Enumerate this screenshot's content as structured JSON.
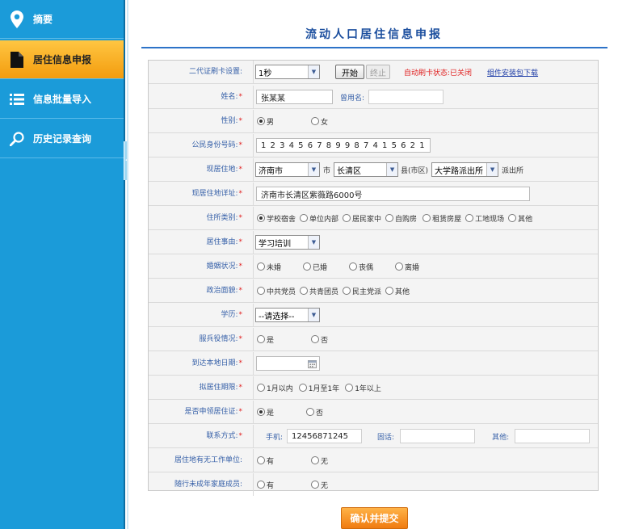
{
  "sidebar": {
    "items": [
      {
        "label": "摘要",
        "icon": "map-pin-icon"
      },
      {
        "label": "居住信息申报",
        "icon": "document-icon"
      },
      {
        "label": "信息批量导入",
        "icon": "list-icon"
      },
      {
        "label": "历史记录查询",
        "icon": "search-icon"
      }
    ]
  },
  "page": {
    "title": "流动人口居住信息申报"
  },
  "form": {
    "card_reader": {
      "label": "二代证刷卡设置:",
      "interval": "1秒",
      "start": "开始",
      "stop": "终止",
      "status": "自动刷卡状态:已关闭",
      "download": "组件安装包下载"
    },
    "name": {
      "label": "姓名:",
      "value": "张某某",
      "former_label": "曾用名:",
      "former_value": ""
    },
    "gender": {
      "label": "性别:",
      "options": [
        "男",
        "女"
      ],
      "selected": "男"
    },
    "id_number": {
      "label": "公民身份号码:",
      "value": "1 2 3 4 5 6 7 8 9 9 8 7 4 1 5 6 2 1"
    },
    "address": {
      "label": "现居住地:",
      "city": "济南市",
      "city_unit": "市",
      "district": "长清区",
      "district_unit": "县(市区)",
      "station": "大学路派出所",
      "station_unit": "派出所"
    },
    "address_detail": {
      "label": "现居住地详址:",
      "value": "济南市长清区紫薇路6000号"
    },
    "residence_type": {
      "label": "住所类别:",
      "options": [
        "学校宿舍",
        "单位内部",
        "居民家中",
        "自购房",
        "租赁房屋",
        "工地现场",
        "其他"
      ],
      "selected": "学校宿舍"
    },
    "reason": {
      "label": "居住事由:",
      "value": "学习培训"
    },
    "marital": {
      "label": "婚姻状况:",
      "options": [
        "未婚",
        "已婚",
        "丧偶",
        "离婚"
      ]
    },
    "political": {
      "label": "政治面貌:",
      "options": [
        "中共党员",
        "共青团员",
        "民主党派",
        "其他"
      ]
    },
    "education": {
      "label": "学历:",
      "value": "--请选择--"
    },
    "military": {
      "label": "服兵役情况:",
      "options": [
        "是",
        "否"
      ]
    },
    "arrival_date": {
      "label": "到达本地日期:",
      "value": ""
    },
    "planned_stay": {
      "label": "拟居住期限:",
      "options": [
        "1月以内",
        "1月至1年",
        "1年以上"
      ]
    },
    "apply_permit": {
      "label": "是否申领居住证:",
      "options": [
        "是",
        "否"
      ],
      "selected": "是"
    },
    "contact": {
      "label": "联系方式:",
      "mobile_label": "手机:",
      "mobile_value": "12456871245",
      "phone_label": "固话:",
      "phone_value": "",
      "other_label": "其他:",
      "other_value": ""
    },
    "has_employer": {
      "label": "居住地有无工作单位:",
      "options": [
        "有",
        "无"
      ]
    },
    "minor_members": {
      "label": "随行未成年家庭成员:",
      "options": [
        "有",
        "无"
      ]
    }
  },
  "submit_label": "确认并提交",
  "colors": {
    "sidebar": "#1b9bd9",
    "active": "#f39c0e",
    "title": "#1b4e9e",
    "label": "#3660a8",
    "required": "#e02020"
  }
}
